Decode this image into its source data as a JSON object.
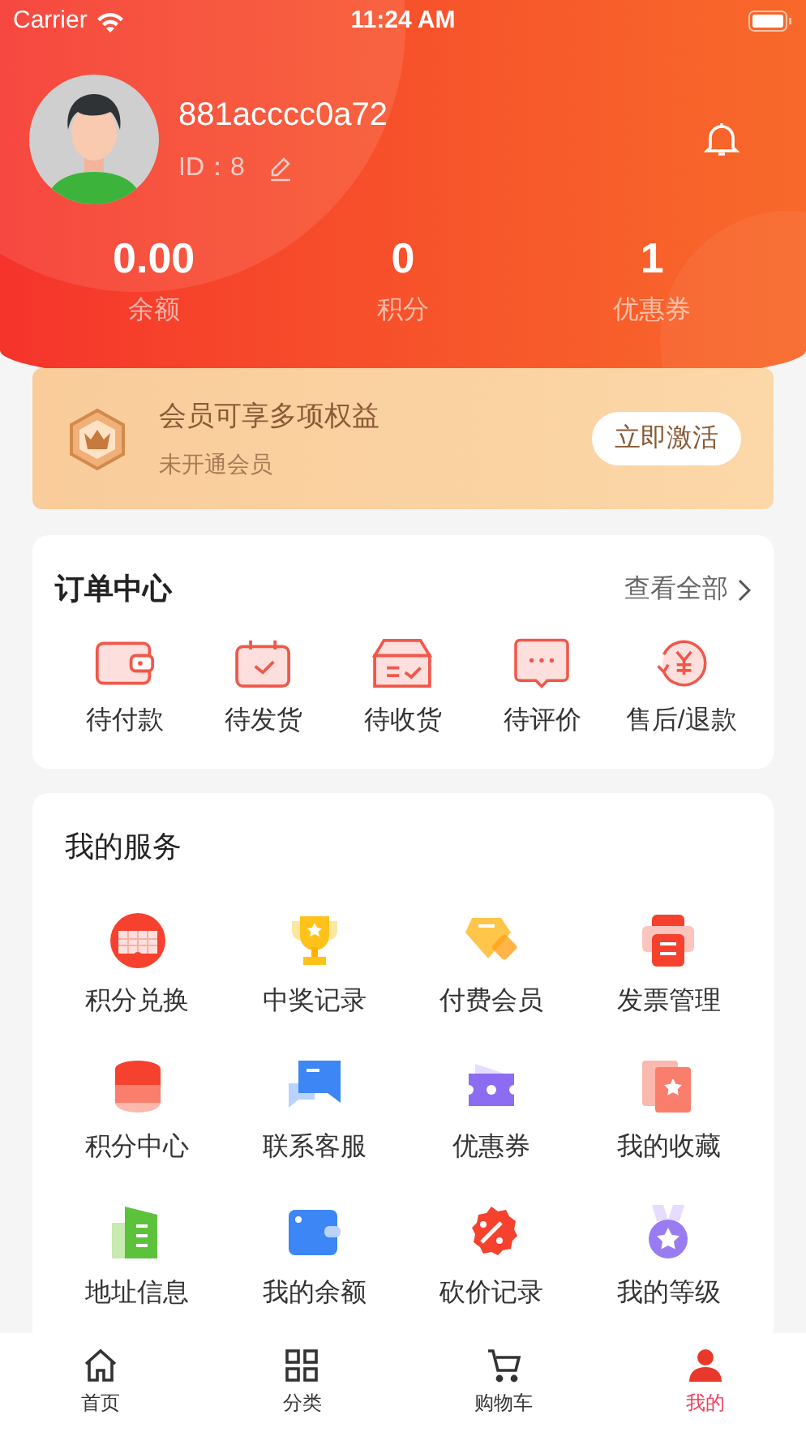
{
  "status_bar": {
    "carrier": "Carrier",
    "time": "11:24 AM"
  },
  "profile": {
    "username": "881acccc0a72",
    "id_text": "ID：8"
  },
  "stats": [
    {
      "value": "0.00",
      "label": "余额"
    },
    {
      "value": "0",
      "label": "积分"
    },
    {
      "value": "1",
      "label": "优惠券"
    }
  ],
  "membership": {
    "title": "会员可享多项权益",
    "subtitle": "未开通会员",
    "button": "立即激活"
  },
  "orders": {
    "title": "订单中心",
    "view_all": "查看全部",
    "items": [
      {
        "label": "待付款"
      },
      {
        "label": "待发货"
      },
      {
        "label": "待收货"
      },
      {
        "label": "待评价"
      },
      {
        "label": "售后/退款"
      }
    ]
  },
  "services": {
    "title": "我的服务",
    "items": [
      {
        "label": "积分兑换"
      },
      {
        "label": "中奖记录"
      },
      {
        "label": "付费会员"
      },
      {
        "label": "发票管理"
      },
      {
        "label": "积分中心"
      },
      {
        "label": "联系客服"
      },
      {
        "label": "优惠券"
      },
      {
        "label": "我的收藏"
      },
      {
        "label": "地址信息"
      },
      {
        "label": "我的余额"
      },
      {
        "label": "砍价记录"
      },
      {
        "label": "我的等级"
      }
    ]
  },
  "tab_bar": [
    {
      "label": "首页",
      "selected": false
    },
    {
      "label": "分类",
      "selected": false
    },
    {
      "label": "购物车",
      "selected": false
    },
    {
      "label": "我的",
      "selected": true
    }
  ]
}
